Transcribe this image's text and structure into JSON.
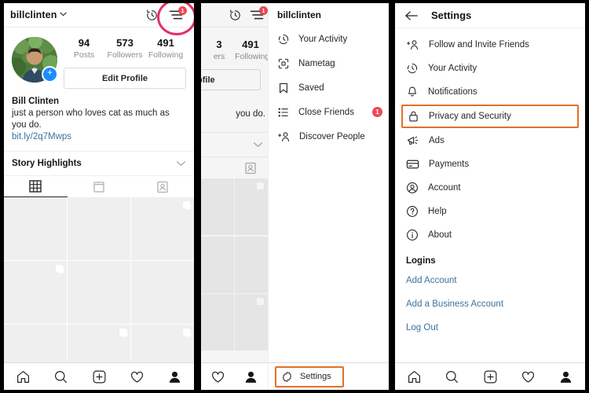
{
  "colors": {
    "accent_pink": "#e1306c",
    "highlight_orange": "#e2702a",
    "badge_red": "#ed4956",
    "link_blue": "#3f729b",
    "plus_blue": "#1a8cff",
    "text_primary": "#262626",
    "text_muted": "#8e8e8e"
  },
  "profile_panel": {
    "username": "billclinten",
    "caret_icon": "chevron-down-icon",
    "history_icon": "activity-history-icon",
    "menu_icon": "hamburger-menu-icon",
    "menu_badge": "1",
    "avatar_icon": "profile-avatar",
    "add_story_label": "+",
    "stats": [
      {
        "value": "94",
        "label": "Posts"
      },
      {
        "value": "573",
        "label": "Followers"
      },
      {
        "value": "491",
        "label": "Following"
      }
    ],
    "edit_profile_label": "Edit Profile",
    "display_name": "Bill Clinten",
    "bio": "just a person who loves cat as much as you do.",
    "website": "bit.ly/2q7Mwps",
    "story_highlights_label": "Story Highlights",
    "story_highlights_chevron": "chevron-down-icon",
    "tabs": [
      {
        "name": "grid-tab",
        "icon": "grid-icon",
        "active": true
      },
      {
        "name": "list-tab",
        "icon": "single-column-icon",
        "active": false
      },
      {
        "name": "tagged-tab",
        "icon": "tagged-person-icon",
        "active": false
      }
    ],
    "grid_cells": [
      {
        "multi": false
      },
      {
        "multi": false
      },
      {
        "multi": true
      },
      {
        "multi": true
      },
      {
        "multi": false
      },
      {
        "multi": false
      },
      {
        "multi": false
      },
      {
        "multi": true
      },
      {
        "multi": true
      },
      {
        "multi": false
      },
      {
        "multi": false
      },
      {
        "multi": false
      }
    ],
    "bottom_nav": [
      {
        "name": "home-nav",
        "icon": "home-icon"
      },
      {
        "name": "search-nav",
        "icon": "search-icon"
      },
      {
        "name": "add-post-nav",
        "icon": "plus-square-icon"
      },
      {
        "name": "activity-nav",
        "icon": "heart-icon"
      },
      {
        "name": "profile-nav",
        "icon": "person-filled-icon"
      }
    ]
  },
  "drawer_panel": {
    "header_username": "billclinten",
    "history_icon": "activity-history-icon",
    "menu_icon": "hamburger-menu-icon",
    "menu_badge": "1",
    "items": [
      {
        "label": "Your Activity",
        "icon": "activity-clock-icon",
        "badge": ""
      },
      {
        "label": "Nametag",
        "icon": "nametag-icon",
        "badge": ""
      },
      {
        "label": "Saved",
        "icon": "bookmark-icon",
        "badge": ""
      },
      {
        "label": "Close Friends",
        "icon": "close-friends-list-icon",
        "badge": "1"
      },
      {
        "label": "Discover People",
        "icon": "discover-people-icon",
        "badge": ""
      }
    ],
    "settings_label": "Settings",
    "settings_icon": "gear-icon",
    "underlay": {
      "followers_value_partial": "3",
      "followers_label_partial": "ers",
      "following_value": "491",
      "following_label": "Following",
      "edit_profile_partial": "ofile",
      "bio_partial": "you do."
    }
  },
  "settings_panel": {
    "back_icon": "arrow-left-icon",
    "title": "Settings",
    "items": [
      {
        "label": "Follow and Invite Friends",
        "icon": "add-person-icon",
        "highlighted": false
      },
      {
        "label": "Your Activity",
        "icon": "activity-clock-icon",
        "highlighted": false
      },
      {
        "label": "Notifications",
        "icon": "bell-icon",
        "highlighted": false
      },
      {
        "label": "Privacy and Security",
        "icon": "lock-icon",
        "highlighted": true
      },
      {
        "label": "Ads",
        "icon": "megaphone-icon",
        "highlighted": false
      },
      {
        "label": "Payments",
        "icon": "credit-card-icon",
        "highlighted": false
      },
      {
        "label": "Account",
        "icon": "account-circle-icon",
        "highlighted": false
      },
      {
        "label": "Help",
        "icon": "help-circle-icon",
        "highlighted": false
      },
      {
        "label": "About",
        "icon": "info-circle-icon",
        "highlighted": false
      }
    ],
    "logins_header": "Logins",
    "links": [
      {
        "label": "Add Account"
      },
      {
        "label": "Add a Business Account"
      },
      {
        "label": "Log Out"
      }
    ],
    "bottom_nav": [
      {
        "name": "home-nav",
        "icon": "home-icon"
      },
      {
        "name": "search-nav",
        "icon": "search-icon"
      },
      {
        "name": "add-post-nav",
        "icon": "plus-square-icon"
      },
      {
        "name": "activity-nav",
        "icon": "heart-icon"
      },
      {
        "name": "profile-nav",
        "icon": "person-filled-icon"
      }
    ]
  }
}
